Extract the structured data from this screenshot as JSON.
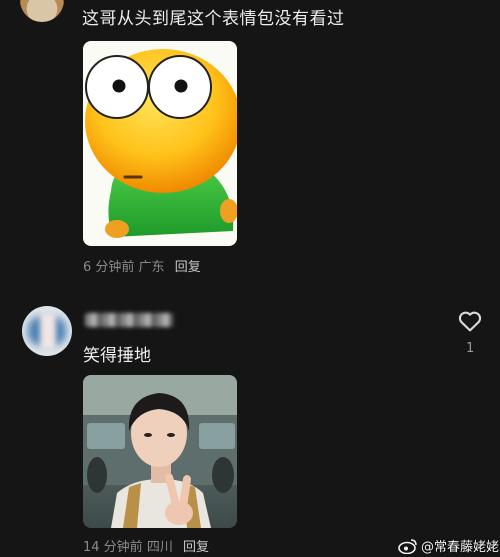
{
  "comments": [
    {
      "text": "这哥从头到尾这个表情包没有看过",
      "time": "6 分钟前",
      "location": "广东",
      "reply_label": "回复",
      "image_icon": "green-shirt-emoji-sticker"
    },
    {
      "username": "",
      "text": "笑得捶地",
      "time": "14 分钟前",
      "location": "四川",
      "reply_label": "回复",
      "like_count": "1",
      "image_icon": "peace-sign-photo"
    }
  ],
  "like_icon": "heart-outline-icon",
  "watermark": {
    "icon": "weibo-icon",
    "text": "@常春藤姥姥"
  },
  "colors": {
    "background": "#151515",
    "text": "#ececec",
    "meta": "#8a8a8a",
    "reply": "#c8c8c8"
  }
}
